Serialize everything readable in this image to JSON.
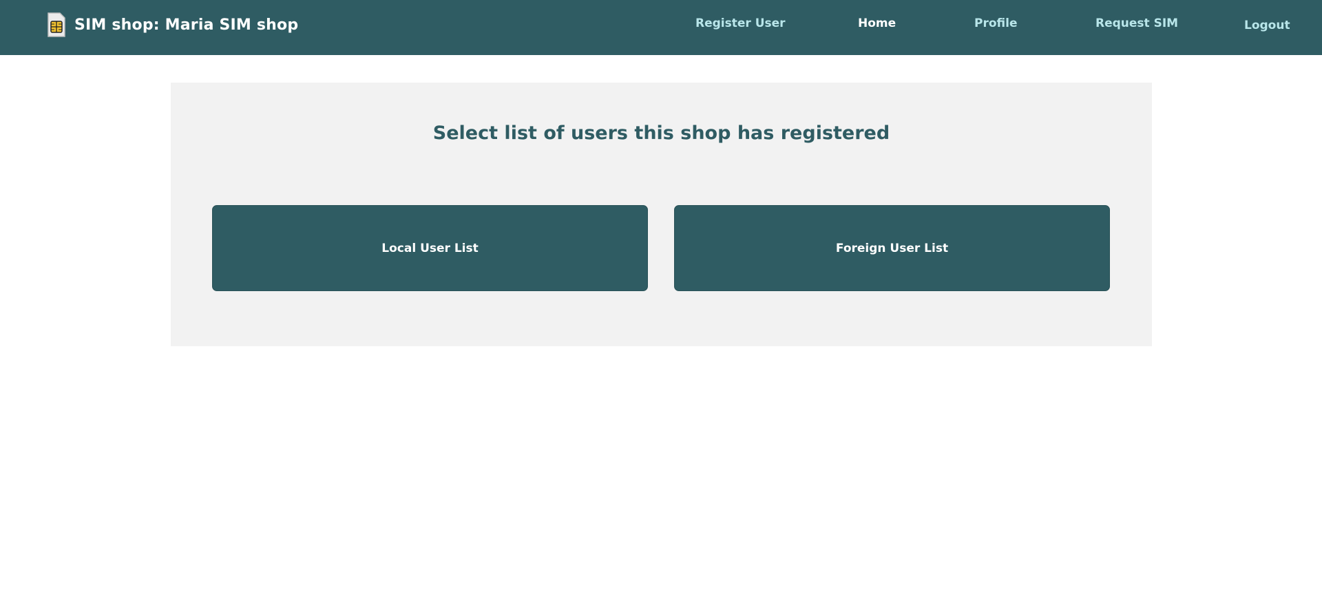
{
  "header": {
    "title": "SIM shop: Maria SIM shop",
    "icon": "sim-card-icon"
  },
  "nav": {
    "register_user": "Register User",
    "home": "Home",
    "profile": "Profile",
    "request_sim": "Request SIM",
    "logout": "Logout",
    "active": "home"
  },
  "main": {
    "heading": "Select list of users this shop has registered",
    "local_button": "Local User List",
    "foreign_button": "Foreign User List"
  },
  "colors": {
    "brand": "#2f5c63",
    "nav_link": "#b9e6ea",
    "panel_bg": "#f2f2f2",
    "sim_chip": "#f2c230"
  }
}
